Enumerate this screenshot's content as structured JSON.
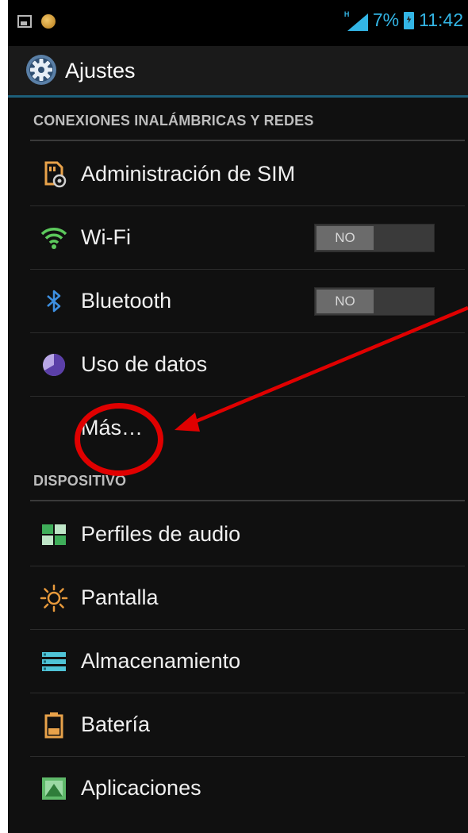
{
  "status_bar": {
    "network": "H",
    "battery_percent": "7%",
    "time": "11:42",
    "accent_color": "#33b5e5"
  },
  "action_bar": {
    "title": "Ajustes",
    "icon": "settings-gear-icon"
  },
  "sections": {
    "wireless": {
      "header": "CONEXIONES INALÁMBRICAS Y REDES",
      "items": [
        {
          "label": "Administración de SIM",
          "icon": "sim-management-icon"
        },
        {
          "label": "Wi-Fi",
          "icon": "wifi-icon",
          "toggle": "NO"
        },
        {
          "label": "Bluetooth",
          "icon": "bluetooth-icon",
          "toggle": "NO"
        },
        {
          "label": "Uso de datos",
          "icon": "data-usage-icon"
        },
        {
          "label": "Más…"
        }
      ]
    },
    "device": {
      "header": "DISPOSITIVO",
      "items": [
        {
          "label": "Perfiles de audio",
          "icon": "audio-profiles-icon"
        },
        {
          "label": "Pantalla",
          "icon": "display-brightness-icon"
        },
        {
          "label": "Almacenamiento",
          "icon": "storage-icon"
        },
        {
          "label": "Batería",
          "icon": "battery-icon"
        },
        {
          "label": "Aplicaciones",
          "icon": "apps-icon"
        }
      ]
    }
  },
  "annotation": {
    "color": "#e00000",
    "highlighted_item": "Más…"
  }
}
